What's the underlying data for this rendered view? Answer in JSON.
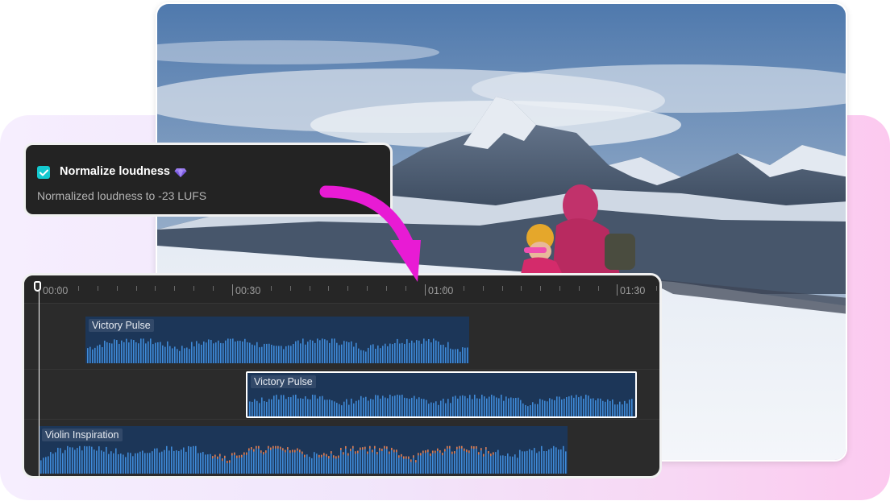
{
  "popup": {
    "checkbox_checked": true,
    "title": "Normalize loudness",
    "premium_icon": "gem-icon",
    "description": "Normalized loudness to -23 LUFS"
  },
  "timeline": {
    "ruler_labels": [
      "00:00",
      "00:30",
      "01:00",
      "01:30"
    ],
    "tracks": [
      {
        "label": "Victory Pulse",
        "selected": false
      },
      {
        "label": "Victory Pulse",
        "selected": true
      },
      {
        "label": "Violin Inspiration",
        "selected": false
      }
    ]
  },
  "colors": {
    "accent_check": "#14c9cf",
    "arrow": "#e81bd4",
    "clip_bg": "#1c3658",
    "waveform": "#3f8ad8",
    "peak": "#e07a4a"
  }
}
